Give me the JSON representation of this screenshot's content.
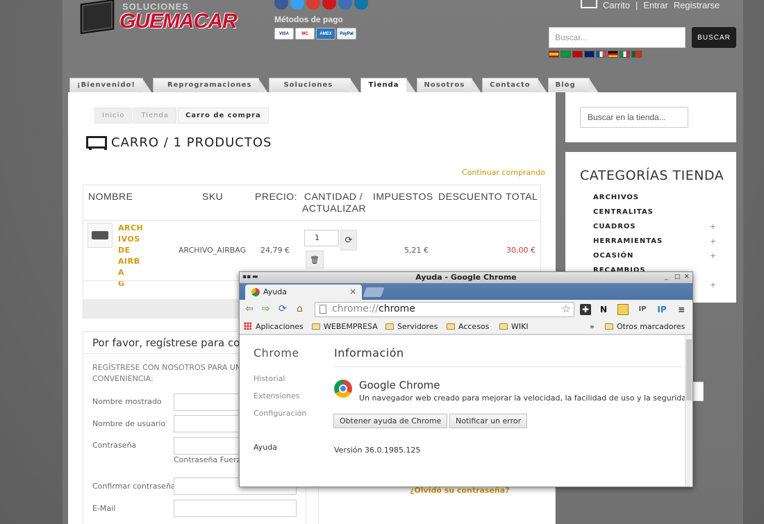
{
  "header": {
    "logo_small": "SOLUCIONES",
    "logo_big": "GUEMACAR",
    "payment_title": "Métodos de pago",
    "payment_cards": [
      "VISA",
      "MC",
      "AMEX",
      "PayPal"
    ],
    "top_links": [
      "Carrito",
      "|",
      "Entrar",
      "Registrarse"
    ],
    "search_placeholder": "Buscar...",
    "search_button": "BUSCAR"
  },
  "nav": {
    "tabs": [
      "¡Bienvenido!",
      "Reprogramaciones",
      "Soluciones",
      "Tienda",
      "Nosotros",
      "Contacto",
      "Blog"
    ]
  },
  "breadcrumb": [
    "Inicio",
    "Tienda",
    "Carro de compra"
  ],
  "cart": {
    "title": "CARRO / 1 PRODUCTOS",
    "continue": "Continuar comprando",
    "columns": [
      "NOMBRE",
      "SKU",
      "PRECIO:",
      "CANTIDAD / ACTUALIZAR",
      "IMPUESTOS",
      "DESCUENTO",
      "TOTAL"
    ],
    "item": {
      "name": "ARCHIVOS DE AIRBAG",
      "name_lines": [
        "ARCH",
        "IVOS",
        "DE",
        "AIRBA",
        "G"
      ],
      "sku": "ARCHIVO_AIRBAG",
      "price": "24,79 €",
      "quantity": "1",
      "tax": "5,21 €",
      "total": "30,00 €"
    }
  },
  "register": {
    "title": "Por favor, regístrese para con",
    "note": "REGÍSTRESE CON NOSOTROS PARA UNA CONVENIENCIA:",
    "labels": [
      "Nombre mostrado",
      "Nombre de usuario",
      "Contraseña",
      "Confirmar contraseña",
      "E-Mail"
    ],
    "password_strength": "Contraseña Fuerz"
  },
  "login": {
    "forgot": "¿Olvidó su contraseña?"
  },
  "sidebar": {
    "search_placeholder": "Buscar en la tienda...",
    "categories_title": "CATEGORÍAS TIENDA",
    "categories": [
      "ARCHIVOS",
      "CENTRALITAS",
      "CUADROS",
      "HERRAMIENTAS",
      "OCASIÓN",
      "RECAMBIOS"
    ]
  },
  "chrome": {
    "window_title": "Ayuda - Google Chrome",
    "tab_title": "Ayuda",
    "url_scheme": "chrome://",
    "url_host": "chrome",
    "bookmarks": [
      "Aplicaciones",
      "WEBEMPRESA",
      "Servidores",
      "Accesos",
      "WIKI",
      "»",
      "Otros marcadores"
    ],
    "side_title": "Chrome",
    "side_items": [
      "Historial",
      "Extensiones",
      "Configuración",
      "Ayuda"
    ],
    "page_title": "Información",
    "product_name": "Google Chrome",
    "product_desc": "Un navegador web creado para mejorar la velocidad, la facilidad de uso y la seguridad",
    "btn_help": "Obtener ayuda de Chrome",
    "btn_report": "Notificar un error",
    "version": "Versión 36.0.1985.125"
  }
}
